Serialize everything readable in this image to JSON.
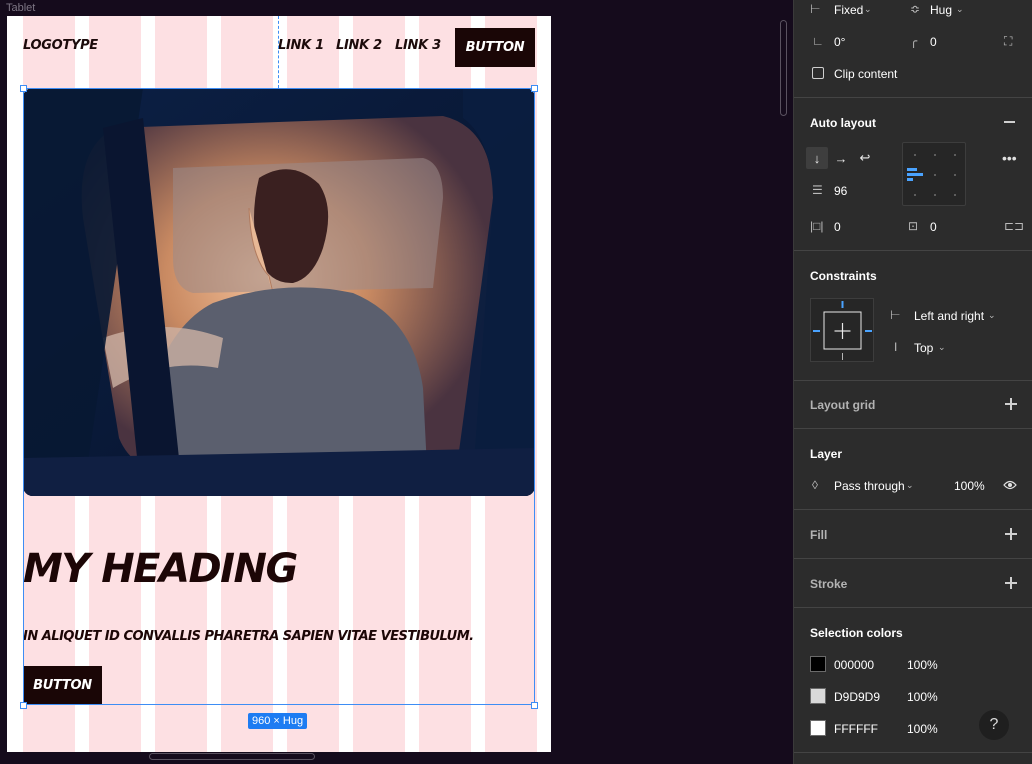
{
  "canvas": {
    "frame_label": "Tablet",
    "nav": {
      "logo": "LOGOTYPE",
      "links": [
        "LINK 1",
        "LINK 2",
        "LINK 3"
      ],
      "button": "BUTTON"
    },
    "heading": "MY HEADING",
    "subheading": "IN ALIQUET ID CONVALLIS PHARETRA SAPIEN VITAE VESTIBULUM.",
    "cta_button": "BUTTON",
    "size_badge": "960 × Hug"
  },
  "panel": {
    "sizing": {
      "width_mode": "Fixed",
      "height_mode": "Hug",
      "rotation": "0°",
      "corner_radius": "0"
    },
    "clip_content": {
      "label": "Clip content",
      "checked": false
    },
    "auto_layout": {
      "title": "Auto layout",
      "direction": "vertical",
      "gap": "96",
      "padding_horizontal": "0",
      "padding_vertical": "0"
    },
    "constraints": {
      "title": "Constraints",
      "horizontal": "Left and right",
      "vertical": "Top"
    },
    "layout_grid": {
      "title": "Layout grid"
    },
    "layer": {
      "title": "Layer",
      "blend": "Pass through",
      "opacity": "100%"
    },
    "fill": {
      "title": "Fill"
    },
    "stroke": {
      "title": "Stroke"
    },
    "selection_colors": {
      "title": "Selection colors",
      "items": [
        {
          "hex": "000000",
          "opacity": "100%",
          "color": "#000000"
        },
        {
          "hex": "D9D9D9",
          "opacity": "100%",
          "color": "#D9D9D9"
        },
        {
          "hex": "FFFFFF",
          "opacity": "100%",
          "color": "#FFFFFF"
        }
      ]
    },
    "help": "?"
  },
  "colors": {
    "canvas_bg": "#150b1c",
    "grid_column": "#fde0e3",
    "selection": "#3d8df5",
    "panel_bg": "#2c2c2c",
    "button_bg": "#1a0606"
  }
}
